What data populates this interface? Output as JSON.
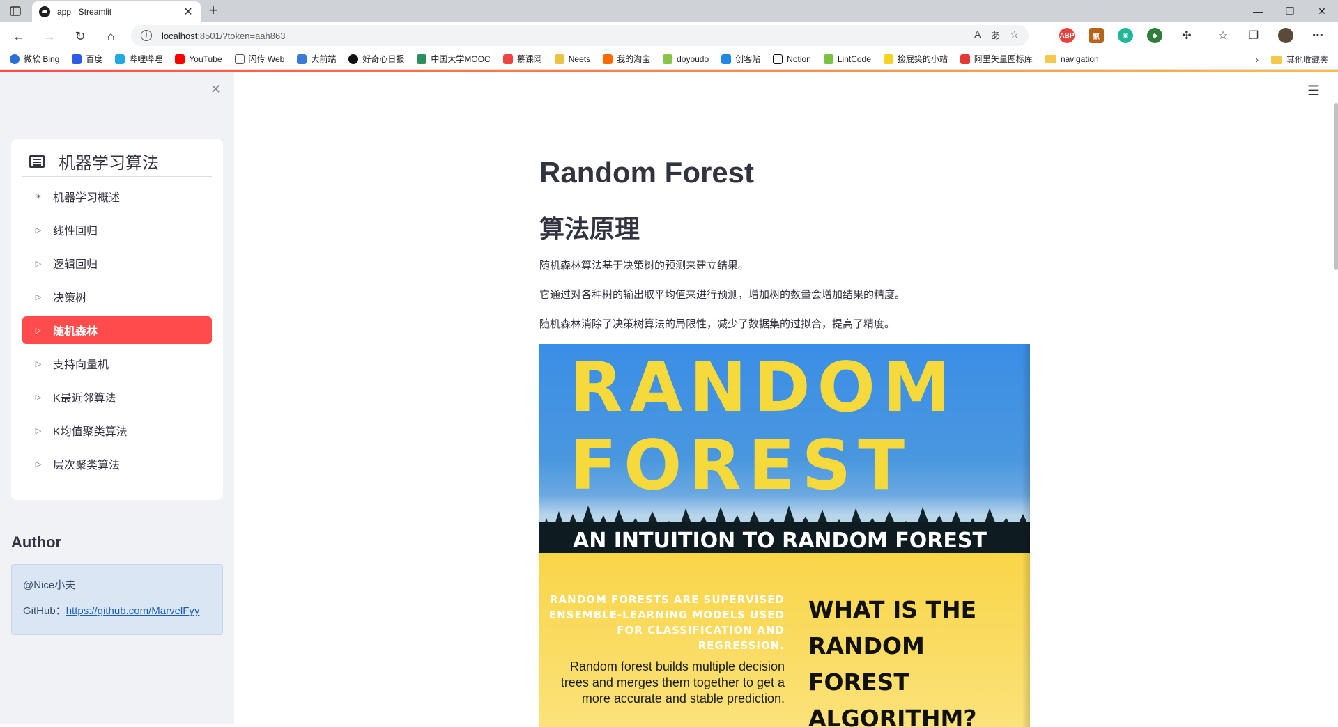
{
  "browser": {
    "tab_title": "app · Streamlit",
    "url_host": "localhost",
    "url_rest": ":8501/?token=aah863",
    "bookmarks": [
      "微软 Bing",
      "百度",
      "哔哩哔哩",
      "YouTube",
      "闪传 Web",
      "大前端",
      "好奇心日报",
      "中国大学MOOC",
      "慕课网",
      "Neets",
      "我的淘宝",
      "doyoudo",
      "创客贴",
      "Notion",
      "LintCode",
      "捡屁笑的小站",
      "阿里矢量图标库",
      "navigation"
    ],
    "other_bookmarks": "其他收藏夹",
    "colors": {
      "accent": "#ff4b4b",
      "accent2": "#ffbd45"
    }
  },
  "sidebar": {
    "menu_title": "机器学习算法",
    "items": [
      {
        "label": "机器学习概述",
        "icon": "sun-icon"
      },
      {
        "label": "线性回归",
        "icon": "caret-right-icon"
      },
      {
        "label": "逻辑回归",
        "icon": "caret-right-icon"
      },
      {
        "label": "决策树",
        "icon": "caret-right-icon"
      },
      {
        "label": "随机森林",
        "icon": "caret-right-icon",
        "active": true
      },
      {
        "label": "支持向量机",
        "icon": "caret-right-icon"
      },
      {
        "label": "K最近邻算法",
        "icon": "caret-right-icon"
      },
      {
        "label": "K均值聚类算法",
        "icon": "caret-right-icon"
      },
      {
        "label": "层次聚类算法",
        "icon": "caret-right-icon"
      }
    ],
    "author_title": "Author",
    "author_name": "@Nice小夫",
    "github_label": "GitHub：",
    "github_link": "https://github.com/MarvelFyy"
  },
  "main": {
    "title": "Random Forest",
    "section": "算法原理",
    "paragraphs": [
      "随机森林算法基于决策树的预测来建立结果。",
      "它通过对各种树的输出取平均值来进行预测，增加树的数量会增加结果的精度。",
      "随机森林消除了决策树算法的局限性，减少了数据集的过拟合，提高了精度。"
    ],
    "poster": {
      "word1": "RANDOM",
      "word2": "FOREST",
      "subtitle": "AN INTUITION TO RANDOM FOREST",
      "caps": "RANDOM FORESTS ARE SUPERVISED ENSEMBLE-LEARNING MODELS USED FOR CLASSIFICATION AND REGRESSION.",
      "body": "Random forest builds multiple decision trees and merges them together to get a more accurate and stable prediction.",
      "question": "WHAT IS THE RANDOM FOREST ALGORITHM?"
    }
  }
}
